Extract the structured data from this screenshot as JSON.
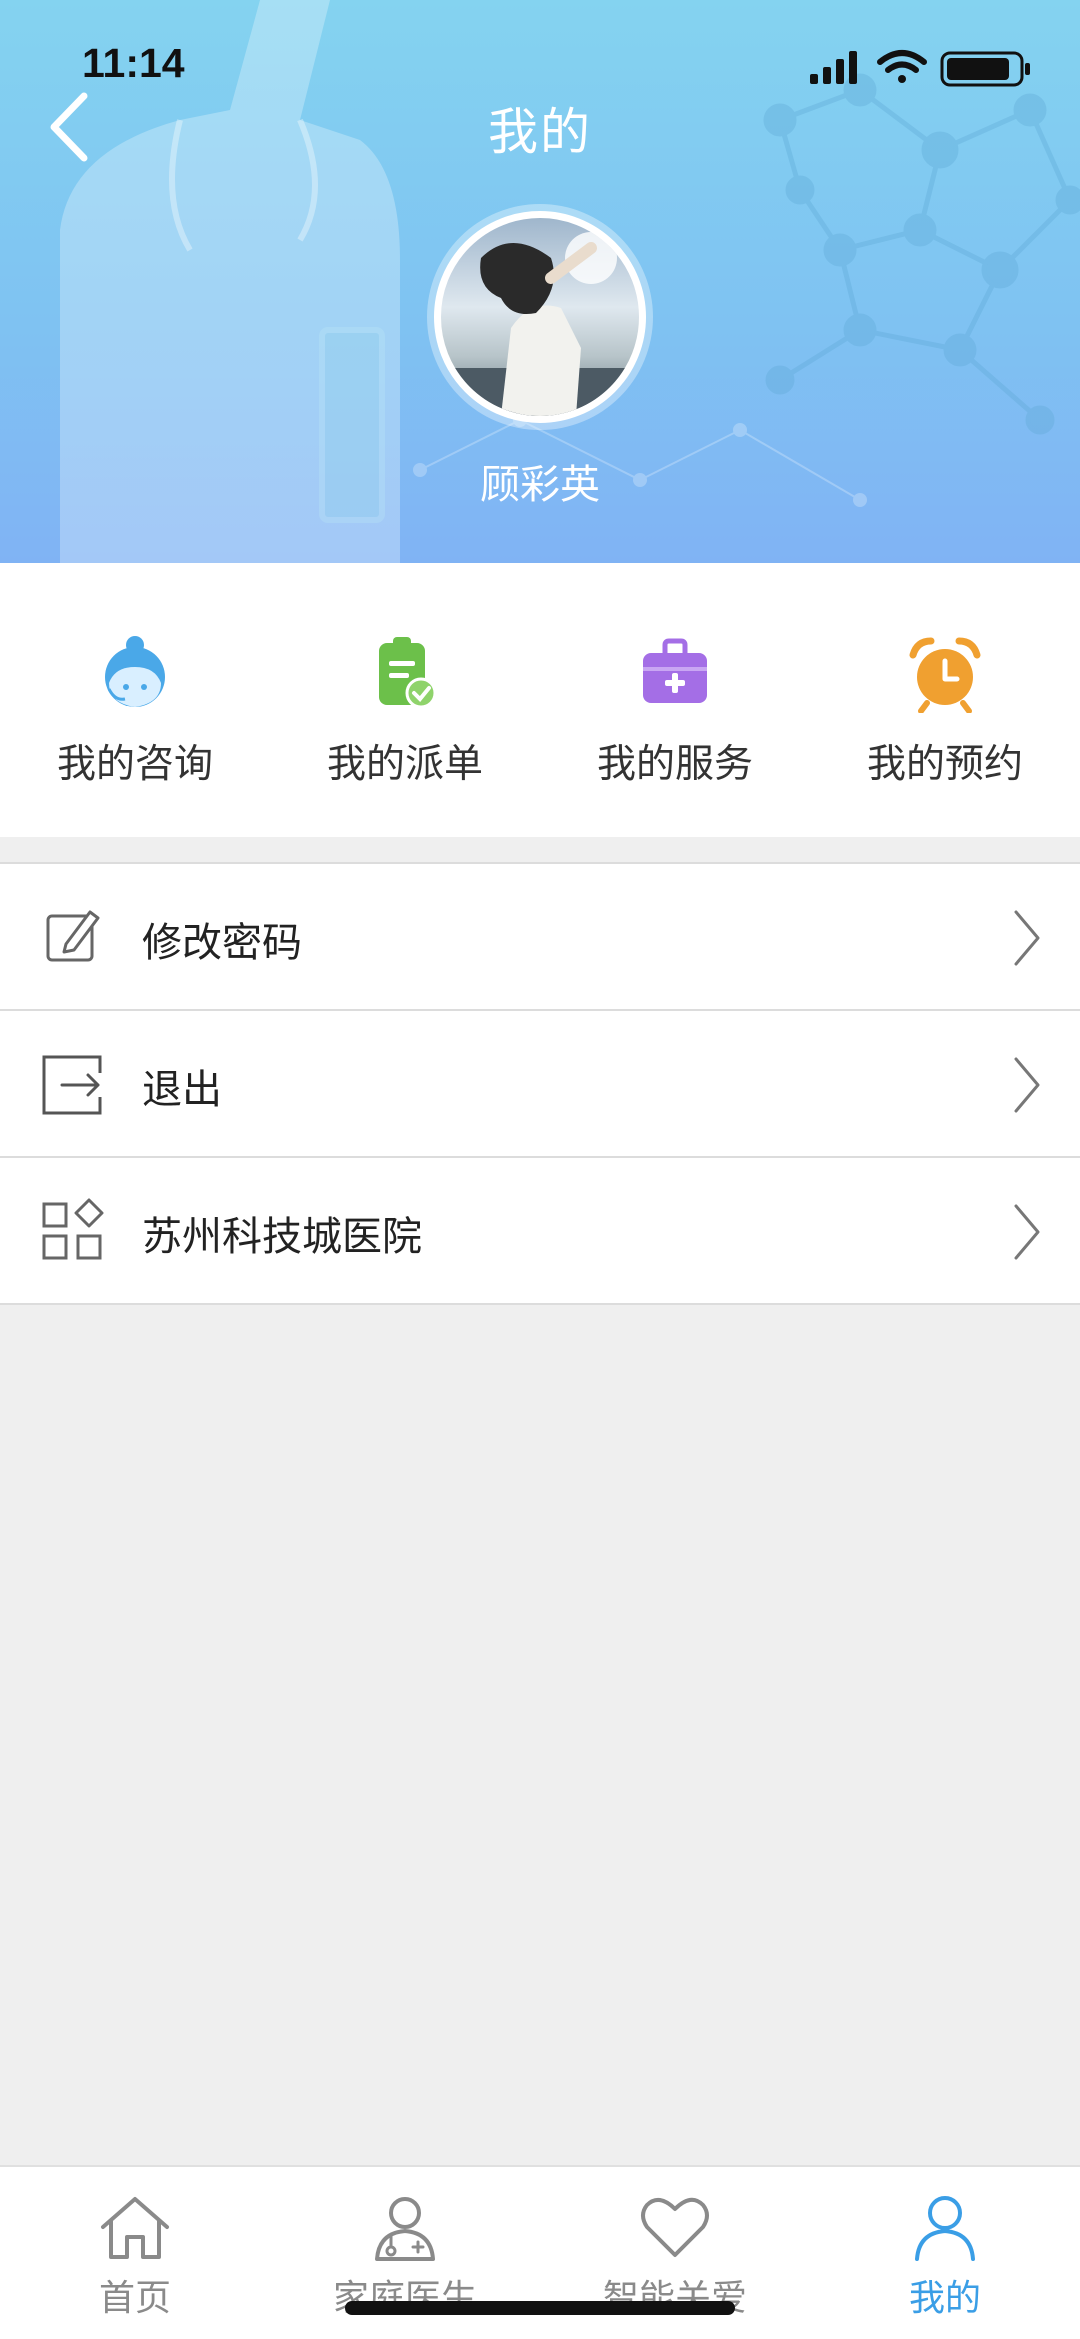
{
  "status_bar": {
    "time": "11:14"
  },
  "header": {
    "title": "我的",
    "user_name": "顾彩英"
  },
  "quick_actions": [
    {
      "label": "我的咨询",
      "icon": "customer-service-icon",
      "color": "#4aa8e8"
    },
    {
      "label": "我的派单",
      "icon": "clipboard-check-icon",
      "color": "#6cc04a"
    },
    {
      "label": "我的服务",
      "icon": "medical-kit-icon",
      "color": "#a46ee6"
    },
    {
      "label": "我的预约",
      "icon": "alarm-clock-icon",
      "color": "#f0a030"
    }
  ],
  "menu": [
    {
      "label": "修改密码",
      "icon": "edit-icon"
    },
    {
      "label": "退出",
      "icon": "logout-icon"
    },
    {
      "label": "苏州科技城医院",
      "icon": "apps-icon"
    }
  ],
  "tabbar": {
    "active_color": "#3a9ee6",
    "items": [
      {
        "label": "首页",
        "icon": "home-icon"
      },
      {
        "label": "家庭医生",
        "icon": "doctor-icon"
      },
      {
        "label": "智能关爱",
        "icon": "heart-icon"
      },
      {
        "label": "我的",
        "icon": "user-icon",
        "active": true
      }
    ]
  }
}
